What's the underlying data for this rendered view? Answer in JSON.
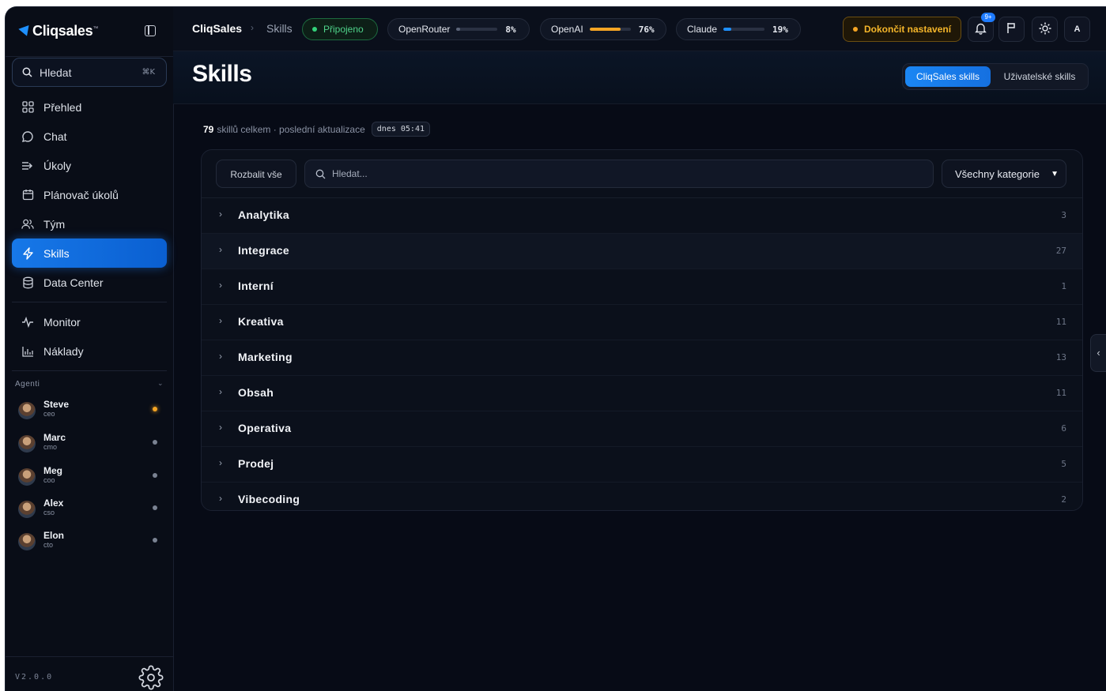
{
  "brand": {
    "logo_text": "Cliqsales",
    "trademark": "™"
  },
  "sidebar": {
    "search_label": "Hledat",
    "search_shortcut": "⌘K",
    "nav": [
      {
        "label": "Přehled",
        "icon": "grid-icon"
      },
      {
        "label": "Chat",
        "icon": "chat-bubble-icon"
      },
      {
        "label": "Úkoly",
        "icon": "list-arrow-icon"
      },
      {
        "label": "Plánovač úkolů",
        "icon": "calendar-icon"
      },
      {
        "label": "Tým",
        "icon": "users-icon"
      },
      {
        "label": "Skills",
        "icon": "lightning-icon",
        "active": true
      },
      {
        "label": "Data Center",
        "icon": "database-icon"
      },
      {
        "label": "Monitor",
        "icon": "pulse-icon"
      },
      {
        "label": "Náklady",
        "icon": "bar-chart-icon"
      }
    ],
    "agents_title": "Agenti",
    "agents": [
      {
        "name": "Steve",
        "role": "ceo",
        "status": "active"
      },
      {
        "name": "Marc",
        "role": "cmo",
        "status": "idle"
      },
      {
        "name": "Meg",
        "role": "coo",
        "status": "idle"
      },
      {
        "name": "Alex",
        "role": "cso",
        "status": "idle"
      },
      {
        "name": "Elon",
        "role": "cto",
        "status": "idle"
      }
    ],
    "version": "V2.0.0"
  },
  "topbar": {
    "app_name": "CliqSales",
    "separator": "›",
    "current_page": "Skills",
    "connection_status": "Připojeno",
    "meters": [
      {
        "label": "OpenRouter",
        "percent": 8,
        "percent_text": "8%",
        "color": "#5b6478"
      },
      {
        "label": "OpenAI",
        "percent": 76,
        "percent_text": "76%",
        "color": "#f5a524"
      },
      {
        "label": "Claude",
        "percent": 19,
        "percent_text": "19%",
        "color": "#1e90ff"
      }
    ],
    "setup_label": "Dokončit nastavení",
    "notifications_badge": "9+",
    "avatar_letter": "A"
  },
  "header": {
    "title": "Skills",
    "tabs": [
      {
        "label": "CliqSales skills",
        "active": true
      },
      {
        "label": "Uživatelské skills",
        "active": false
      }
    ]
  },
  "summary": {
    "count": "79",
    "text": "skillů celkem · poslední aktualizace",
    "updated": "dnes 05:41"
  },
  "toolbar": {
    "expand_all": "Rozbalit vše",
    "search_placeholder": "Hledat...",
    "category_select": "Všechny kategorie"
  },
  "categories": [
    {
      "name": "Analytika",
      "count": "3"
    },
    {
      "name": "Integrace",
      "count": "27"
    },
    {
      "name": "Interní",
      "count": "1"
    },
    {
      "name": "Kreativa",
      "count": "11"
    },
    {
      "name": "Marketing",
      "count": "13"
    },
    {
      "name": "Obsah",
      "count": "11"
    },
    {
      "name": "Operativa",
      "count": "6"
    },
    {
      "name": "Prodej",
      "count": "5"
    },
    {
      "name": "Vibecoding",
      "count": "2"
    }
  ],
  "colors": {
    "accent": "#1778e8",
    "warning": "#f5a524",
    "success": "#33d17a",
    "background": "#070b16"
  }
}
